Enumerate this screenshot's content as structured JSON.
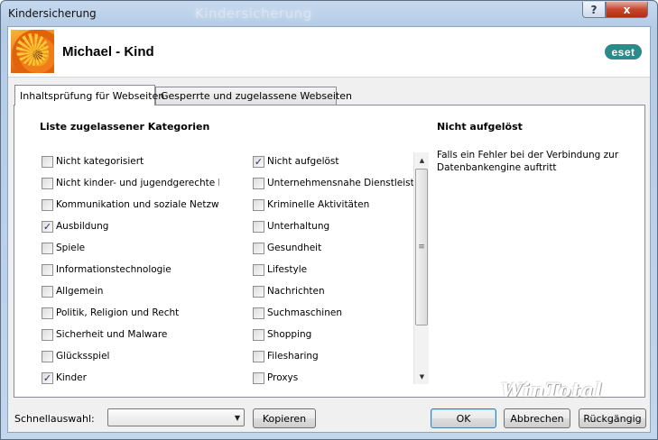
{
  "window": {
    "title": "Kindersicherung",
    "ghost_title": "Kindersicherung",
    "help_glyph": "?",
    "close_glyph": "x"
  },
  "header": {
    "user_name": "Michael - Kind",
    "brand": "eset"
  },
  "tabs": [
    {
      "label": "Inhaltsprüfung für Webseiten",
      "active": true
    },
    {
      "label": "Gesperrte und zugelassene Webseiten",
      "active": false
    }
  ],
  "categories": {
    "title": "Liste zugelassener Kategorien",
    "left": [
      {
        "label": "Nicht kategorisiert",
        "checked": false
      },
      {
        "label": "Nicht kinder- und jugendgerechte Inha",
        "checked": false
      },
      {
        "label": "Kommunikation und soziale Netzwerke",
        "checked": false
      },
      {
        "label": "Ausbildung",
        "checked": true
      },
      {
        "label": "Spiele",
        "checked": false
      },
      {
        "label": "Informationstechnologie",
        "checked": false
      },
      {
        "label": "Allgemein",
        "checked": false
      },
      {
        "label": "Politik, Religion und Recht",
        "checked": false
      },
      {
        "label": "Sicherheit und Malware",
        "checked": false
      },
      {
        "label": "Glücksspiel",
        "checked": false
      },
      {
        "label": "Kinder",
        "checked": true
      }
    ],
    "right": [
      {
        "label": "Nicht aufgelöst",
        "checked": true
      },
      {
        "label": "Unternehmensnahe Dienstleistu",
        "checked": false
      },
      {
        "label": "Kriminelle Aktivitäten",
        "checked": false
      },
      {
        "label": "Unterhaltung",
        "checked": false
      },
      {
        "label": "Gesundheit",
        "checked": false
      },
      {
        "label": "Lifestyle",
        "checked": false
      },
      {
        "label": "Nachrichten",
        "checked": false
      },
      {
        "label": "Suchmaschinen",
        "checked": false
      },
      {
        "label": "Shopping",
        "checked": false
      },
      {
        "label": "Filesharing",
        "checked": false
      },
      {
        "label": "Proxys",
        "checked": false
      }
    ]
  },
  "info": {
    "title": "Nicht aufgelöst",
    "text": "Falls ein Fehler bei der Verbindung zur Datenbankengine auftritt"
  },
  "watermark": "WinTotal",
  "bottom": {
    "quick_label": "Schnellauswahl:",
    "select_value": "",
    "copy_button": "Kopieren",
    "ok_button": "OK",
    "cancel_button": "Abbrechen",
    "undo_button": "Rückgängig"
  },
  "icons": {
    "check_glyph": "✓",
    "scroll_up": "▲",
    "scroll_down": "▼",
    "scroll_grip": "≡",
    "dropdown": "▼"
  },
  "colors": {
    "eset_brand": "#2b8a8a",
    "close_button": "#c8452c",
    "title_bar": "#c6d9ee"
  }
}
